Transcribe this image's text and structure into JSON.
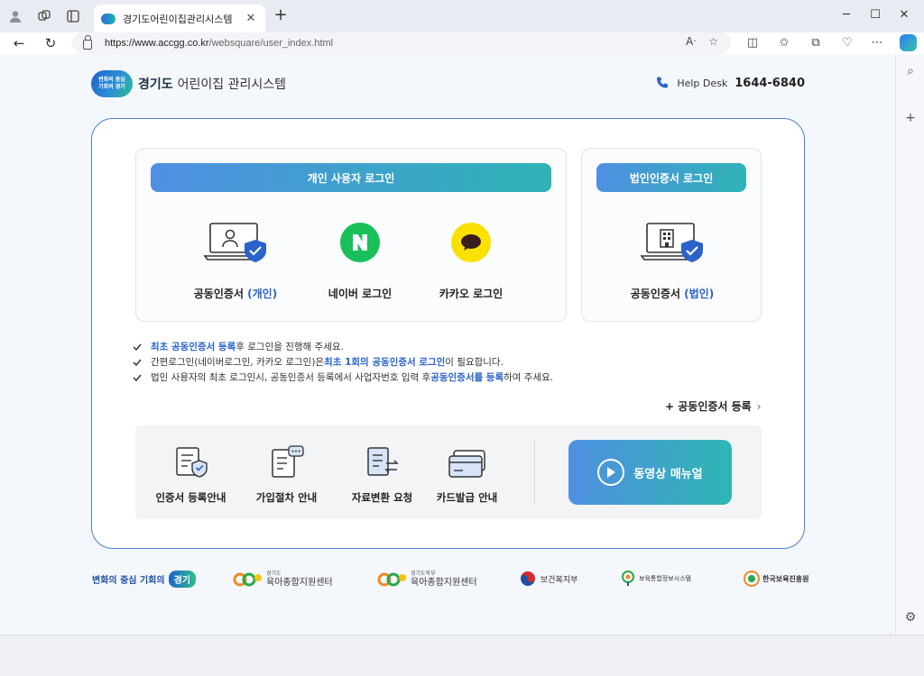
{
  "browser": {
    "tab_title": "경기도어린이집관리시스템",
    "url_host": "https://www.accgg.co.kr",
    "url_path": "/websquare/user_index.html"
  },
  "header": {
    "logo_badge": "변화의 중심\n기회의 경기",
    "logo_bold": "경기도",
    "logo_rest": "어린이집 관리시스템",
    "help_label": "Help Desk",
    "help_number": "1644-6840"
  },
  "personal": {
    "title": "개인 사용자 로그인",
    "cert_label_pre": "공동인증서 ",
    "cert_label_hl": "(개인)",
    "naver_label": "네이버 로그인",
    "kakao_label": "카카오 로그인"
  },
  "corporate": {
    "title": "법인인증서 로그인",
    "cert_label_pre": "공동인증서 ",
    "cert_label_hl": "(법인)"
  },
  "notices": [
    {
      "a": "최초 공동인증서 등록",
      "b": " 후 로그인을 진행해 주세요.",
      "c": "",
      "d": ""
    },
    {
      "a": "",
      "b": "간편로그인(네이버로그인, 카카오 로그인)은 ",
      "c": "최초 1회의 공동인증서 로그인",
      "d": " 이 필요합니다."
    },
    {
      "a": "",
      "b": "법인 사용자의 최초 로그인시, 공동인증서 등록에서 사업자번호 입력 후 ",
      "c": "공동인증서를 등록",
      "d": "하여 주세요."
    }
  ],
  "register_link": "+ 공동인증서 등록",
  "guides": [
    {
      "label": "인증서 등록안내",
      "icon": "certificate-shield-icon"
    },
    {
      "label": "가입절차 안내",
      "icon": "document-chat-icon"
    },
    {
      "label": "자료변환 요청",
      "icon": "document-convert-icon"
    },
    {
      "label": "카드발급 안내",
      "icon": "card-icon"
    }
  ],
  "video_label": "동영상 매뉴얼",
  "footer": {
    "gg_text": "변화의 중심 기회의",
    "gg_badge": "경기",
    "center1_small": "경기도",
    "center1": "육아종합지원센터",
    "center2_small": "경기도북부",
    "center2": "육아종합지원센터",
    "ministry": "보건복지부",
    "info": "보육통합정보시스템",
    "institute": "한국보육진흥원"
  },
  "colors": {
    "accent_blue": "#2a63c9",
    "gradient_start": "#4f8fe2",
    "gradient_end": "#2fb3b6",
    "naver_green": "#19c05a",
    "kakao_yellow": "#fae100"
  }
}
